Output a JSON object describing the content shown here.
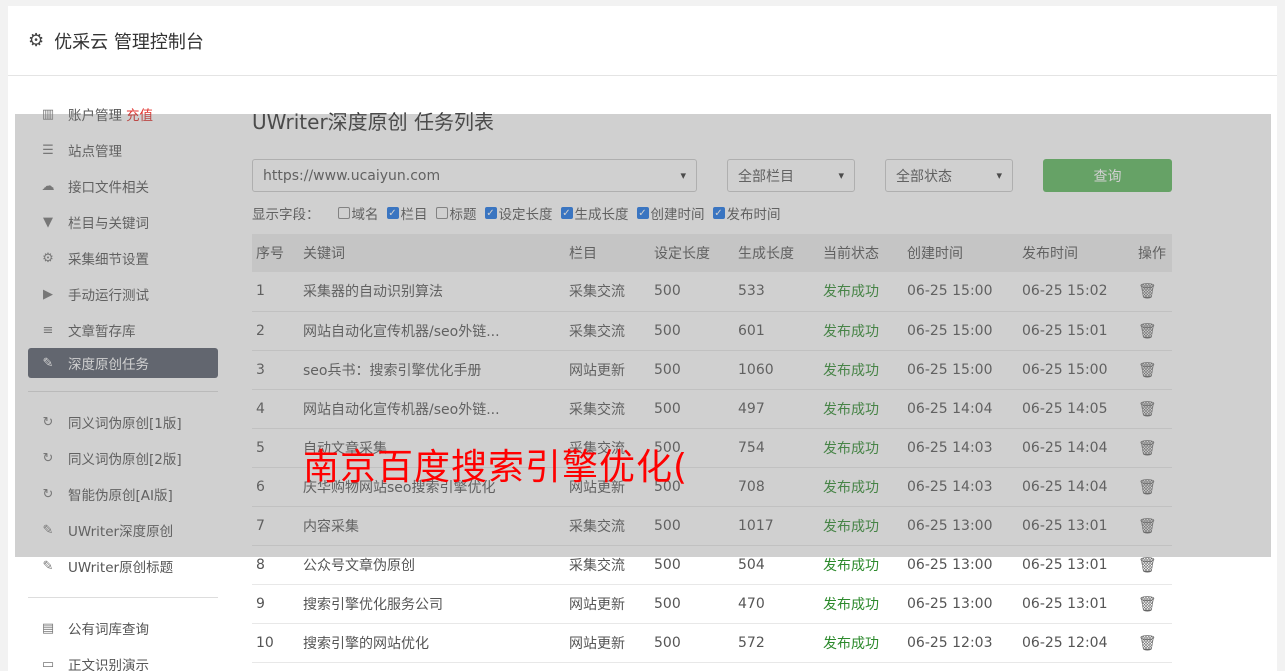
{
  "header": {
    "title": "优采云 管理控制台",
    "icon": "gear-icon"
  },
  "sidebar": {
    "items": [
      {
        "label": "账户管理",
        "icon": "bar-chart-icon",
        "extra": "充值"
      },
      {
        "label": "站点管理",
        "icon": "server-icon"
      },
      {
        "label": "接口文件相关",
        "icon": "cloud-upload-icon"
      },
      {
        "label": "栏目与关键词",
        "icon": "filter-icon"
      },
      {
        "label": "采集细节设置",
        "icon": "cogs-icon"
      },
      {
        "label": "手动运行测试",
        "icon": "play-circle-icon"
      },
      {
        "label": "文章暂存库",
        "icon": "database-icon"
      },
      {
        "label": "深度原创任务",
        "icon": "edit-icon",
        "active": true
      }
    ],
    "items2": [
      {
        "label": "同义词伪原创[1版]",
        "icon": "refresh-icon"
      },
      {
        "label": "同义词伪原创[2版]",
        "icon": "refresh-icon"
      },
      {
        "label": "智能伪原创[AI版]",
        "icon": "refresh-icon"
      },
      {
        "label": "UWriter深度原创",
        "icon": "edit-icon"
      },
      {
        "label": "UWriter原创标题",
        "icon": "edit-icon"
      }
    ],
    "items3": [
      {
        "label": "公有词库查询",
        "icon": "book-icon"
      },
      {
        "label": "正文识别演示",
        "icon": "monitor-icon"
      }
    ]
  },
  "main": {
    "title": "UWriter深度原创 任务列表",
    "site_select": "https://www.ucaiyun.com",
    "column_select": "全部栏目",
    "status_select": "全部状态",
    "query_button": "查询",
    "fields_label": "显示字段：",
    "fields": [
      {
        "label": "域名",
        "checked": false
      },
      {
        "label": "栏目",
        "checked": true
      },
      {
        "label": "标题",
        "checked": false
      },
      {
        "label": "设定长度",
        "checked": true
      },
      {
        "label": "生成长度",
        "checked": true
      },
      {
        "label": "创建时间",
        "checked": true
      },
      {
        "label": "发布时间",
        "checked": true
      }
    ],
    "columns": [
      "序号",
      "关键词",
      "栏目",
      "设定长度",
      "生成长度",
      "当前状态",
      "创建时间",
      "发布时间",
      "操作"
    ],
    "rows": [
      [
        "1",
        "采集器的自动识别算法",
        "采集交流",
        "500",
        "533",
        "发布成功",
        "06-25 15:00",
        "06-25 15:02"
      ],
      [
        "2",
        "网站自动化宣传机器/seo外链...",
        "采集交流",
        "500",
        "601",
        "发布成功",
        "06-25 15:00",
        "06-25 15:01"
      ],
      [
        "3",
        "seo兵书：搜索引擎优化手册",
        "网站更新",
        "500",
        "1060",
        "发布成功",
        "06-25 15:00",
        "06-25 15:00"
      ],
      [
        "4",
        "网站自动化宣传机器/seo外链...",
        "采集交流",
        "500",
        "497",
        "发布成功",
        "06-25 14:04",
        "06-25 14:05"
      ],
      [
        "5",
        "自动文章采集",
        "采集交流",
        "500",
        "754",
        "发布成功",
        "06-25 14:03",
        "06-25 14:04"
      ],
      [
        "6",
        "庆华购物网站seo搜索引擎优化",
        "网站更新",
        "500",
        "708",
        "发布成功",
        "06-25 14:03",
        "06-25 14:04"
      ],
      [
        "7",
        "内容采集",
        "采集交流",
        "500",
        "1017",
        "发布成功",
        "06-25 13:00",
        "06-25 13:01"
      ],
      [
        "8",
        "公众号文章伪原创",
        "采集交流",
        "500",
        "504",
        "发布成功",
        "06-25 13:00",
        "06-25 13:01"
      ],
      [
        "9",
        "搜索引擎优化服务公司",
        "网站更新",
        "500",
        "470",
        "发布成功",
        "06-25 13:00",
        "06-25 13:01"
      ],
      [
        "10",
        "搜索引擎的网站优化",
        "网站更新",
        "500",
        "572",
        "发布成功",
        "06-25 12:03",
        "06-25 12:04"
      ]
    ]
  },
  "overlay_text": "南京百度搜索引擎优化(",
  "colors": {
    "accent": "#5cb85c",
    "active_nav": "#565d6b",
    "success": "#2d8a2d",
    "charge": "#e0312c",
    "watermark": "#ff0000"
  }
}
